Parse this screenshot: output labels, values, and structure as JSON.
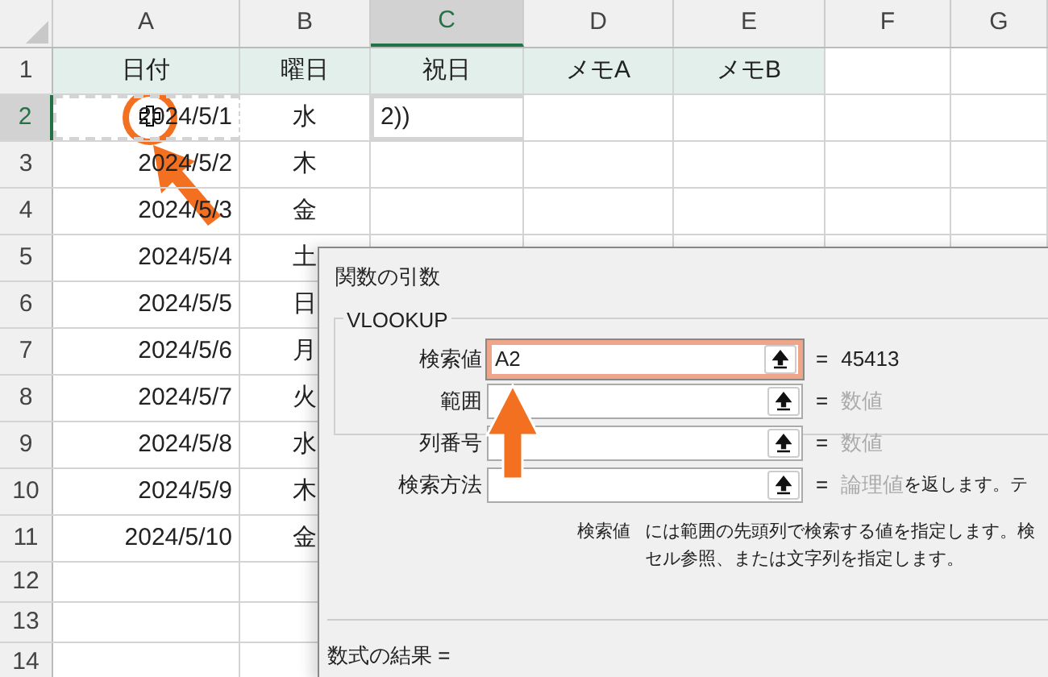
{
  "columns": [
    {
      "label": "A",
      "selected": false
    },
    {
      "label": "B",
      "selected": false
    },
    {
      "label": "C",
      "selected": true
    },
    {
      "label": "D",
      "selected": false
    },
    {
      "label": "E",
      "selected": false
    },
    {
      "label": "F",
      "selected": false
    },
    {
      "label": "G",
      "selected": false
    }
  ],
  "rows": [
    {
      "number": "1",
      "kind": "header",
      "cells": [
        "日付",
        "曜日",
        "祝日",
        "メモA",
        "メモB",
        "",
        ""
      ]
    },
    {
      "number": "2",
      "selected": true,
      "cells": [
        "2024/5/1",
        "水",
        "2))",
        "",
        "",
        "",
        ""
      ]
    },
    {
      "number": "3",
      "cells": [
        "2024/5/2",
        "木",
        "",
        "",
        "",
        "",
        ""
      ]
    },
    {
      "number": "4",
      "cells": [
        "2024/5/3",
        "金",
        "",
        "",
        "",
        "",
        ""
      ]
    },
    {
      "number": "5",
      "cells": [
        "2024/5/4",
        "土",
        "",
        "",
        "",
        "",
        ""
      ]
    },
    {
      "number": "6",
      "cells": [
        "2024/5/5",
        "日",
        "",
        "",
        "",
        "",
        ""
      ]
    },
    {
      "number": "7",
      "cells": [
        "2024/5/6",
        "月",
        "",
        "",
        "",
        "",
        ""
      ]
    },
    {
      "number": "8",
      "cells": [
        "2024/5/7",
        "火",
        "",
        "",
        "",
        "",
        ""
      ]
    },
    {
      "number": "9",
      "cells": [
        "2024/5/8",
        "水",
        "",
        "",
        "",
        "",
        ""
      ]
    },
    {
      "number": "10",
      "cells": [
        "2024/5/9",
        "木",
        "",
        "",
        "",
        "",
        ""
      ]
    },
    {
      "number": "11",
      "cells": [
        "2024/5/10",
        "金",
        "",
        "",
        "",
        "",
        ""
      ]
    },
    {
      "number": "12",
      "kind": "blank",
      "cells": [
        "",
        "",
        "",
        "",
        "",
        "",
        ""
      ]
    },
    {
      "number": "13",
      "kind": "blank",
      "cells": [
        "",
        "",
        "",
        "",
        "",
        "",
        ""
      ]
    },
    {
      "number": "14",
      "kind": "blank",
      "cells": [
        "",
        "",
        "",
        "",
        "",
        "",
        ""
      ]
    }
  ],
  "dialog": {
    "title": "関数の引数",
    "function_name": "VLOOKUP",
    "arguments": [
      {
        "label": "検索値",
        "value": "A2",
        "equals": "=",
        "result": "45413",
        "focused": true
      },
      {
        "label": "範囲",
        "equals": "=",
        "result": "数値",
        "focused": false
      },
      {
        "label": "列番号",
        "equals": "=",
        "result": "数値",
        "focused": false
      },
      {
        "label": "検索方法",
        "equals": "=",
        "result": "論理値",
        "note": "を返します。テ",
        "focused": false
      }
    ],
    "help_label": "検索値",
    "help_text": "には範囲の先頭列で検索する値を指定します。検",
    "help_text_2": "セル参照、または文字列を指定します。",
    "formula_result": "数式の結果 ="
  }
}
